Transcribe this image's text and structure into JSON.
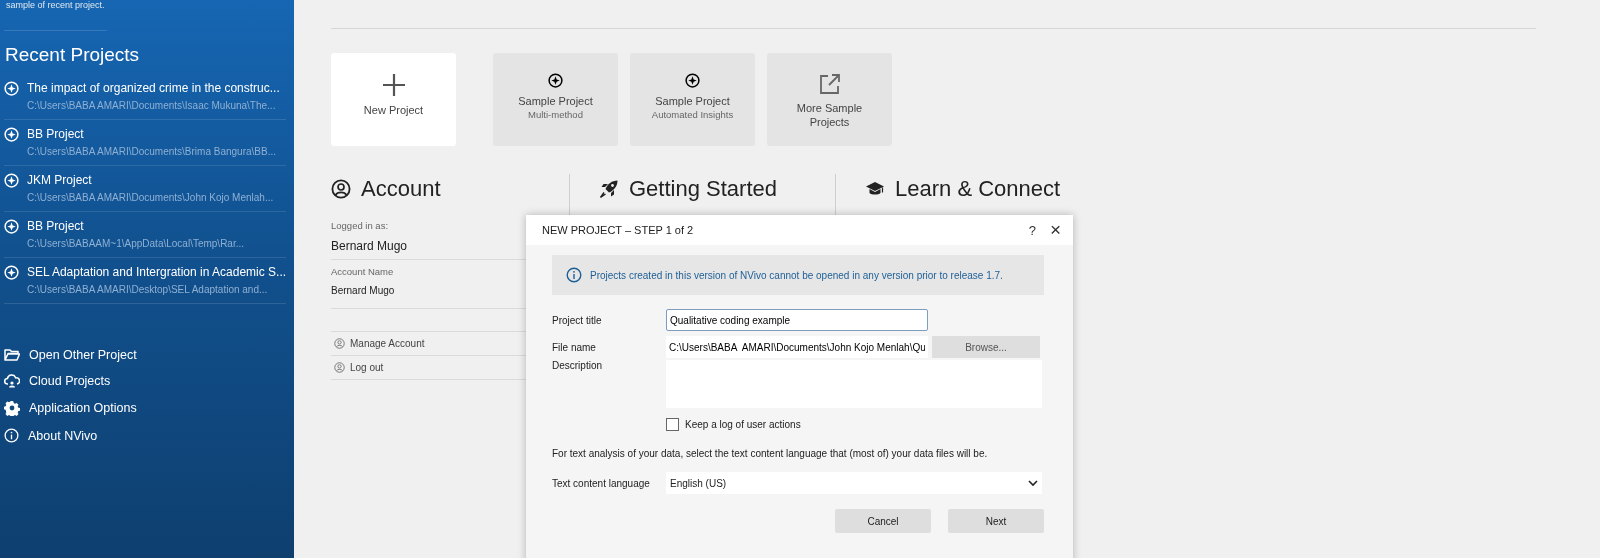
{
  "sidebar": {
    "top_note": "sample of recent project.",
    "recent_heading": "Recent Projects",
    "recent_projects": [
      {
        "title": "The impact of organized crime in the construc...",
        "path": "C:\\Users\\BABA  AMARI\\Documents\\Isaac Mukuna\\The..."
      },
      {
        "title": "BB Project",
        "path": "C:\\Users\\BABA  AMARI\\Documents\\Brima Bangura\\BB..."
      },
      {
        "title": "JKM Project",
        "path": "C:\\Users\\BABA  AMARI\\Documents\\John Kojo Menlah..."
      },
      {
        "title": "BB Project",
        "path": "C:\\Users\\BABAAM~1\\AppData\\Local\\Temp\\Rar..."
      },
      {
        "title": "SEL Adaptation and Intergration in Academic S...",
        "path": "C:\\Users\\BABA  AMARI\\Desktop\\SEL Adaptation and..."
      }
    ],
    "actions": [
      {
        "kind": "folder",
        "label": "Open Other Project"
      },
      {
        "kind": "cloud",
        "label": "Cloud Projects"
      },
      {
        "kind": "gear",
        "label": "Application Options"
      },
      {
        "kind": "info",
        "label": "About NVivo"
      }
    ]
  },
  "tiles": [
    {
      "kind": "new",
      "title": "New Project"
    },
    {
      "kind": "sample",
      "title": "Sample Project",
      "subtitle": "Multi-method"
    },
    {
      "kind": "sample",
      "title": "Sample Project",
      "subtitle": "Automated Insights"
    },
    {
      "kind": "external",
      "title": "More Sample Projects"
    }
  ],
  "sections": [
    {
      "kind": "account",
      "heading": "Account"
    },
    {
      "kind": "rocket",
      "heading": "Getting Started"
    },
    {
      "kind": "cap",
      "heading": "Learn & Connect"
    }
  ],
  "account": {
    "logged_in_label": "Logged in as:",
    "logged_in_name": "Bernard Mugo",
    "account_name_label": "Account Name",
    "account_name": "Bernard Mugo",
    "links": [
      {
        "label": "Manage Account"
      },
      {
        "label": "Log out"
      }
    ]
  },
  "dialog": {
    "title": "NEW PROJECT – STEP 1 of 2",
    "help": "?",
    "close": "×",
    "info": "Projects created in this version of NVivo cannot be opened in any version prior to release 1.7.",
    "project_title": {
      "label": "Project title",
      "value": "Qualitative coding example"
    },
    "file_name": {
      "label": "File name",
      "value": "C:\\Users\\BABA  AMARI\\Documents\\John Kojo Menlah\\Qu",
      "button": "Browse..."
    },
    "description": {
      "label": "Description"
    },
    "log_checkbox": {
      "label": "Keep a log of user actions",
      "checked": false
    },
    "language_note": "For text analysis of your data, select the text content language that (most of) your data files will be.",
    "language": {
      "label": "Text content language",
      "value": "English (US)"
    },
    "buttons": [
      "Cancel",
      "Next"
    ]
  }
}
